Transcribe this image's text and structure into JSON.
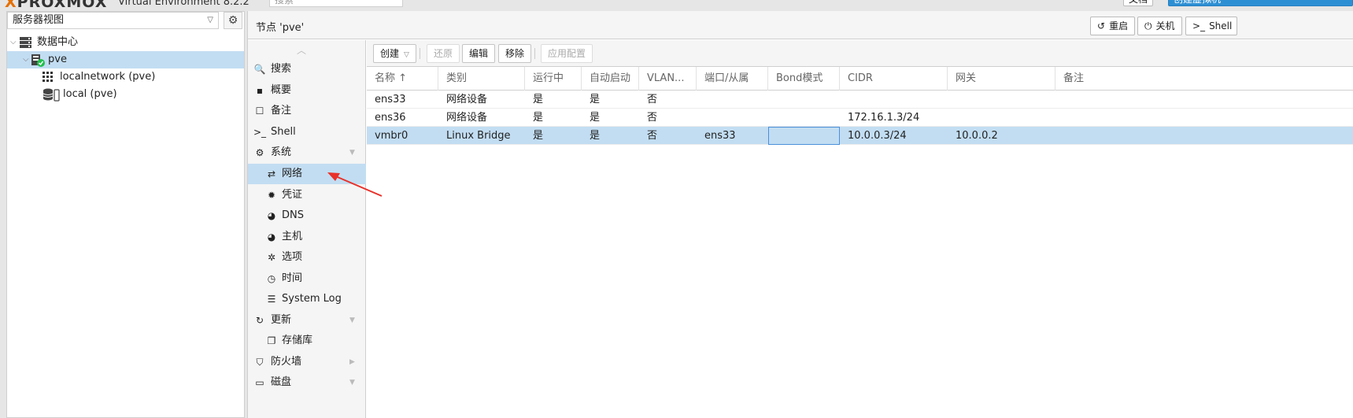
{
  "app": {
    "logo": "PROXMOX",
    "product_title": "Virtual Environment 8.2.2",
    "search_placeholder": "搜索",
    "top_buttons": [
      "文档",
      "创建虚拟机"
    ]
  },
  "left": {
    "view_select": "服务器视图",
    "tree": [
      {
        "label": "数据中心",
        "icon": "datacenter-icon"
      },
      {
        "label": "pve",
        "icon": "node-online-icon"
      },
      {
        "label": "localnetwork (pve)",
        "icon": "sdn-grid-icon"
      },
      {
        "label": "local (pve)",
        "icon": "storage-icon"
      }
    ]
  },
  "header": {
    "title": "节点 'pve'",
    "buttons": [
      {
        "label": "重启",
        "icon": "restart-icon"
      },
      {
        "label": "关机",
        "icon": "power-icon"
      },
      {
        "label": "Shell",
        "icon": "terminal-icon"
      }
    ]
  },
  "menu": [
    {
      "label": "搜索",
      "icon": "search-icon",
      "glyph": "🔍",
      "sub": false
    },
    {
      "label": "概要",
      "icon": "book-icon",
      "glyph": "▪",
      "sub": false
    },
    {
      "label": "备注",
      "icon": "notes-icon",
      "glyph": "☐",
      "sub": false
    },
    {
      "label": "Shell",
      "icon": "terminal-icon",
      "glyph": ">_",
      "sub": false
    },
    {
      "label": "系统",
      "icon": "cogs-icon",
      "glyph": "⚙",
      "sub": false,
      "caret": "▼"
    },
    {
      "label": "网络",
      "icon": "exchange-icon",
      "glyph": "⇄",
      "sub": true,
      "selected": true
    },
    {
      "label": "凭证",
      "icon": "certificate-icon",
      "glyph": "✹",
      "sub": true
    },
    {
      "label": "DNS",
      "icon": "globe-icon",
      "glyph": "◕",
      "sub": true
    },
    {
      "label": "主机",
      "icon": "globe-icon",
      "glyph": "◕",
      "sub": true
    },
    {
      "label": "选项",
      "icon": "gear-icon",
      "glyph": "✲",
      "sub": true
    },
    {
      "label": "时间",
      "icon": "clock-icon",
      "glyph": "◷",
      "sub": true
    },
    {
      "label": "System Log",
      "icon": "list-icon",
      "glyph": "☰",
      "sub": true
    },
    {
      "label": "更新",
      "icon": "refresh-icon",
      "glyph": "↻",
      "sub": false,
      "caret": "▼"
    },
    {
      "label": "存储库",
      "icon": "copy-icon",
      "glyph": "❐",
      "sub": true
    },
    {
      "label": "防火墙",
      "icon": "shield-icon",
      "glyph": "⛉",
      "sub": false,
      "caret": "▶"
    },
    {
      "label": "磁盘",
      "icon": "hdd-icon",
      "glyph": "▭",
      "sub": false,
      "caret": "▼"
    }
  ],
  "toolbar": {
    "create": "创建",
    "revert": "还原",
    "edit": "编辑",
    "remove": "移除",
    "apply": "应用配置"
  },
  "grid": {
    "columns": [
      "名称 ↑",
      "类别",
      "运行中",
      "自动启动",
      "VLAN...",
      "端口/从属",
      "Bond模式",
      "CIDR",
      "网关",
      "备注"
    ],
    "rows": [
      [
        "ens33",
        "网络设备",
        "是",
        "是",
        "否",
        "",
        "",
        "",
        "",
        ""
      ],
      [
        "ens36",
        "网络设备",
        "是",
        "是",
        "否",
        "",
        "",
        "172.16.1.3/24",
        "",
        ""
      ],
      [
        "vmbr0",
        "Linux Bridge",
        "是",
        "是",
        "否",
        "ens33",
        "",
        "10.0.0.3/24",
        "10.0.0.2",
        ""
      ]
    ],
    "selected_row": 2
  },
  "colors": {
    "selection": "#c2ddf2",
    "annotation_arrow": "#e8312a",
    "online_badge": "#21bf4b"
  }
}
